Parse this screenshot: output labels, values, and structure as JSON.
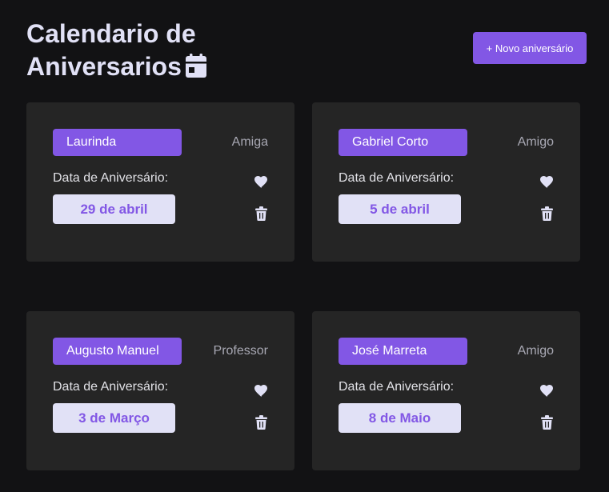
{
  "header": {
    "title": "Calendario de Aniversarios",
    "new_button_label": "+ Novo aniversário"
  },
  "cards": [
    {
      "name": "Laurinda",
      "relation": "Amiga",
      "date_label": "Data de Aniversário:",
      "date": "29 de abril"
    },
    {
      "name": "Gabriel Corto",
      "relation": "Amigo",
      "date_label": "Data de Aniversário:",
      "date": "5 de abril"
    },
    {
      "name": "Augusto Manuel",
      "relation": "Professor",
      "date_label": "Data de Aniversário:",
      "date": "3 de Março"
    },
    {
      "name": "José Marreta",
      "relation": "Amigo",
      "date_label": "Data de Aniversário:",
      "date": "8 de Maio"
    }
  ],
  "colors": {
    "background": "#121214",
    "card": "#252525",
    "accent": "#8257e5",
    "light": "#e1e1f6",
    "muted": "#a8a8b3"
  },
  "icons": {
    "title": "calendar-icon",
    "favorite": "heart-icon",
    "delete": "trash-icon"
  }
}
